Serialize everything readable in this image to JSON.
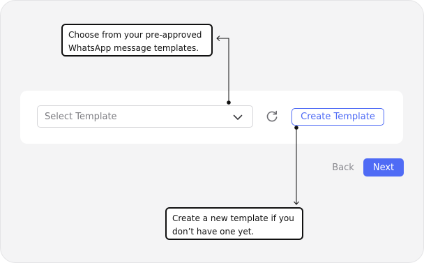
{
  "template_select": {
    "placeholder": "Select Template",
    "icon": "chevron-down-icon"
  },
  "refresh": {
    "icon": "refresh-icon"
  },
  "create_template_label": "Create Template",
  "footer": {
    "back_label": "Back",
    "next_label": "Next"
  },
  "callouts": {
    "top_line1": "Choose from your pre-approved",
    "top_line2": "WhatsApp message templates.",
    "bottom_line1": "Create a new template if you",
    "bottom_line2": "don’t have one yet."
  },
  "colors": {
    "accent": "#4f6bf5",
    "background": "#f4f4f5",
    "card": "#ffffff",
    "callout_border": "#111111"
  }
}
